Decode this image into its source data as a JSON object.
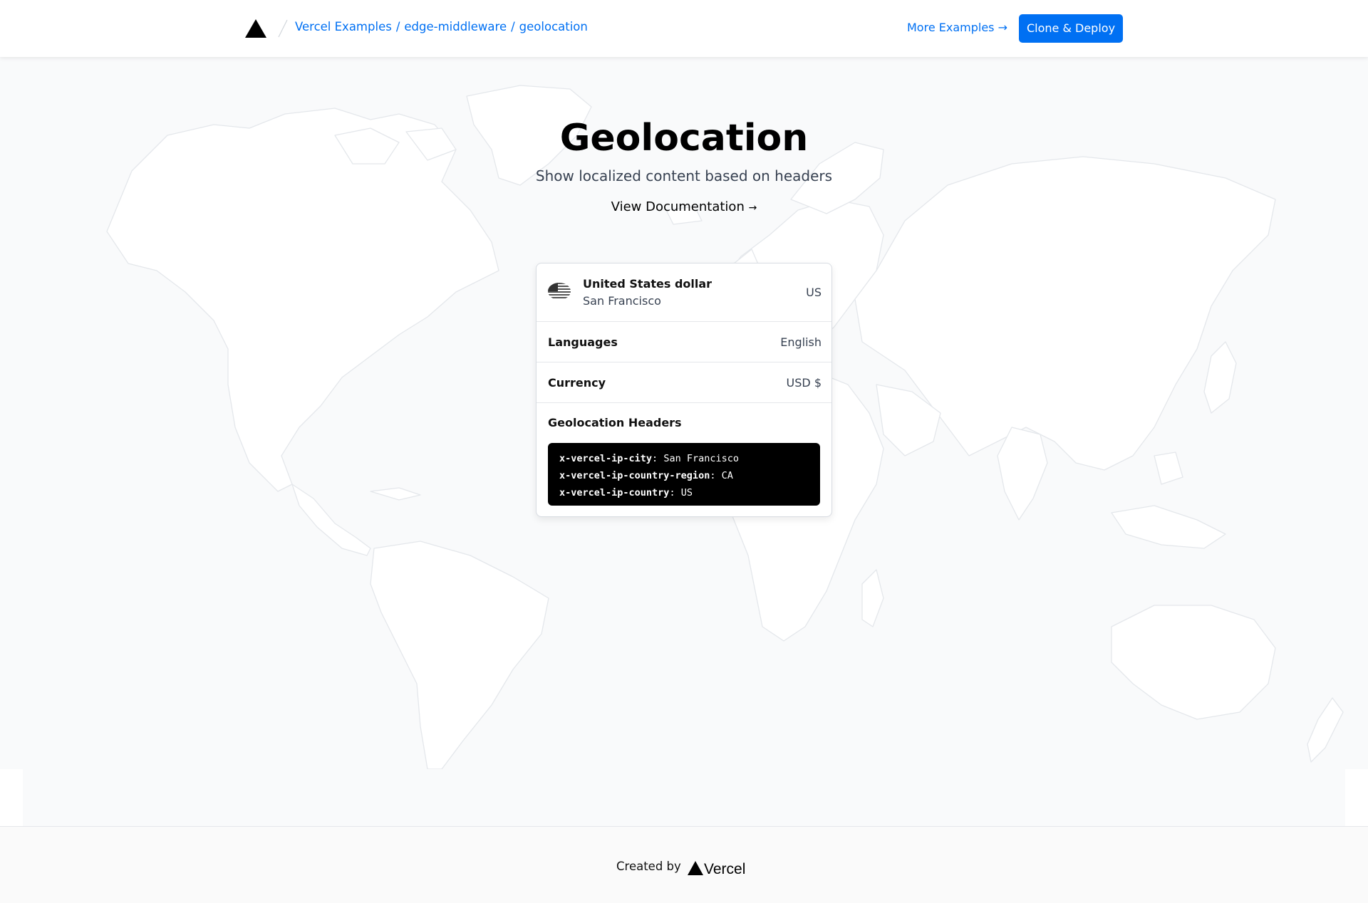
{
  "header": {
    "breadcrumb": [
      {
        "label": "Vercel Examples"
      },
      {
        "label": "edge-middleware"
      },
      {
        "label": "geolocation"
      }
    ],
    "separator": "/",
    "more_examples": "More Examples →",
    "clone_deploy": "Clone & Deploy",
    "logo_icon": "vercel-triangle-icon"
  },
  "hero": {
    "title": "Geolocation",
    "subtitle": "Show localized content based on headers",
    "doc_link": "View Documentation",
    "doc_arrow": "→"
  },
  "card": {
    "flag_icon": "us-flag-icon",
    "currency_name": "United States dollar",
    "city": "San Francisco",
    "country_code": "US",
    "languages_label": "Languages",
    "languages_value": "English",
    "currency_label": "Currency",
    "currency_value": "USD $",
    "headers_title": "Geolocation Headers",
    "headers": [
      {
        "key": "x-vercel-ip-city",
        "value": "San Francisco"
      },
      {
        "key": "x-vercel-ip-country-region",
        "value": "CA"
      },
      {
        "key": "x-vercel-ip-country",
        "value": "US"
      }
    ]
  },
  "footer": {
    "created_by": "Created by",
    "brand": "Vercel"
  },
  "colors": {
    "accent": "#0070f3",
    "map_bg": "#f9fafb",
    "map_land": "#ffffff",
    "map_stroke": "#e4e7eb"
  }
}
